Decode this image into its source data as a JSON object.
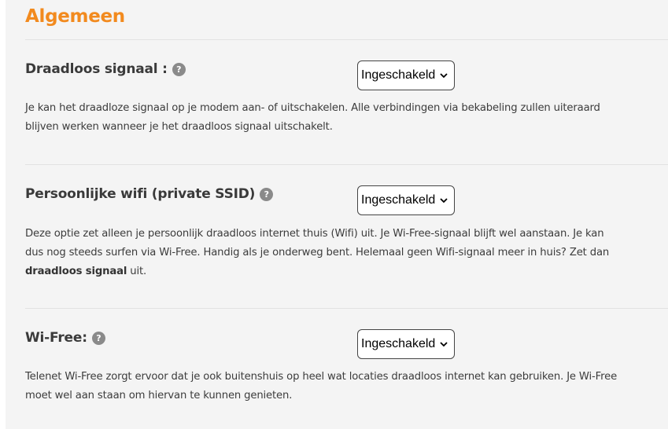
{
  "section": {
    "title": "Algemeen"
  },
  "settings": [
    {
      "label": "Draadloos signaal :",
      "value": "Ingeschakeld",
      "description": "Je kan het draadloze signaal op je modem aan- of uitschakelen. Alle verbindingen via bekabeling zullen uiteraard blijven werken wanneer je het draadloos signaal uitschakelt."
    },
    {
      "label": "Persoonlijke wifi (private SSID)",
      "value": "Ingeschakeld",
      "description_pre": "Deze optie zet alleen je persoonlijk draadloos internet thuis (Wifi) uit. Je Wi-Free-signaal blijft wel aanstaan. Je kan dus nog steeds surfen via Wi-Free. Handig als je onderweg bent. Helemaal geen Wifi-signaal meer in huis? Zet dan ",
      "description_bold": "draadloos signaal",
      "description_post": " uit."
    },
    {
      "label": "Wi-Free:",
      "value": "Ingeschakeld",
      "description": "Telenet Wi-Free zorgt ervoor dat je ook buitenshuis op heel wat locaties draadloos internet kan gebruiken. Je Wi-Free moet wel aan staan om hiervan te kunnen genieten."
    }
  ],
  "help_glyph": "?",
  "icons": {
    "help": "question-circle-icon",
    "dropdown": "chevron-down-icon"
  },
  "colors": {
    "title": "#f28a1e",
    "help_icon": "#8a8a8a",
    "background": "#f4f4f4"
  }
}
